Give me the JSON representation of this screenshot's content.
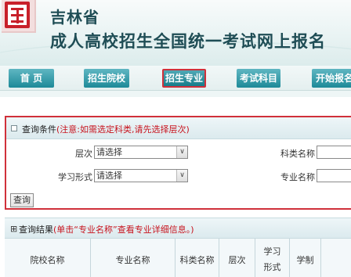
{
  "header": {
    "line1": "吉林省",
    "line2": "成人高校招生全国统一考试网上报名"
  },
  "nav": {
    "items": [
      {
        "label": "首 页"
      },
      {
        "label": "招生院校"
      },
      {
        "label": "招生专业",
        "active": true
      },
      {
        "label": "考试科目"
      },
      {
        "label": "开始报名"
      }
    ]
  },
  "query": {
    "title": "查询条件",
    "note": "(注意:如需选定科类,请先选择层次)",
    "level_label": "层次",
    "level_value": "请选择",
    "study_label": "学习形式",
    "study_value": "请选择",
    "category_label": "科类名称",
    "major_label": "专业名称",
    "button": "查询"
  },
  "results": {
    "plus": "⊞",
    "title": "查询结果",
    "note": "(单击“专业名称”查看专业详细信息。)",
    "columns": [
      "院校名称",
      "专业名称",
      "科类名称",
      "层次",
      "学习",
      "形式",
      "学制"
    ]
  },
  "colors": {
    "accent": "#1d8a98",
    "highlight": "#d0303a",
    "title": "#1f4d55"
  }
}
